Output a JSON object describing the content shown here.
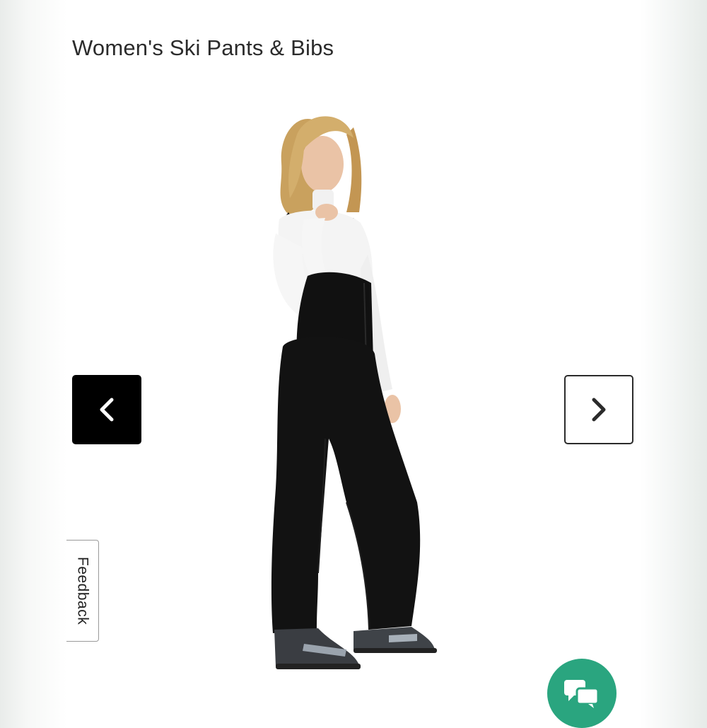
{
  "header": {
    "category_title": "Women's Ski Pants & Bibs"
  },
  "product": {
    "image_subject": "woman in black ski bib pants, white top and ski boots"
  },
  "carousel": {
    "prev_icon": "chevron-left-icon",
    "next_icon": "chevron-right-icon"
  },
  "feedback": {
    "label": "Feedback"
  },
  "chat": {
    "icon": "chat-bubbles-icon",
    "color": "#2aa57f"
  },
  "colors": {
    "prev_button_bg": "#000000",
    "next_button_border": "#2b2b2b",
    "title_text": "#2b2b2b"
  }
}
